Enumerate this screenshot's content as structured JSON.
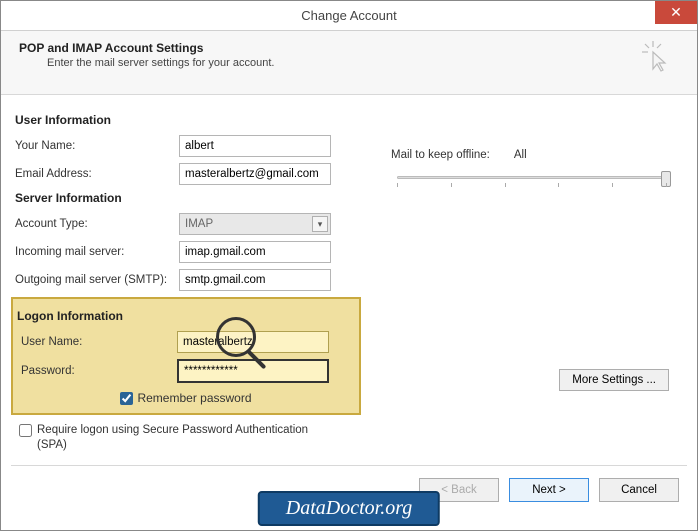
{
  "window": {
    "title": "Change Account",
    "close": "✕"
  },
  "header": {
    "title": "POP and IMAP Account Settings",
    "subtitle": "Enter the mail server settings for your account."
  },
  "sections": {
    "user_info": "User Information",
    "server_info": "Server Information",
    "logon_info": "Logon Information"
  },
  "labels": {
    "your_name": "Your Name:",
    "email": "Email Address:",
    "account_type": "Account Type:",
    "incoming": "Incoming mail server:",
    "outgoing": "Outgoing mail server (SMTP):",
    "user_name": "User Name:",
    "password": "Password:",
    "remember": "Remember password",
    "spa": "Require logon using Secure Password Authentication (SPA)",
    "mail_keep": "Mail to keep offline:",
    "mail_keep_value": "All"
  },
  "values": {
    "your_name": "albert",
    "email": "masteralbertz@gmail.com",
    "account_type": "IMAP",
    "incoming": "imap.gmail.com",
    "outgoing": "smtp.gmail.com",
    "user_name": "masteralbertz",
    "password": "************",
    "remember_checked": true,
    "spa_checked": false
  },
  "buttons": {
    "more": "More Settings ...",
    "back": "< Back",
    "next": "Next >",
    "cancel": "Cancel"
  },
  "watermark": "DataDoctor.org"
}
